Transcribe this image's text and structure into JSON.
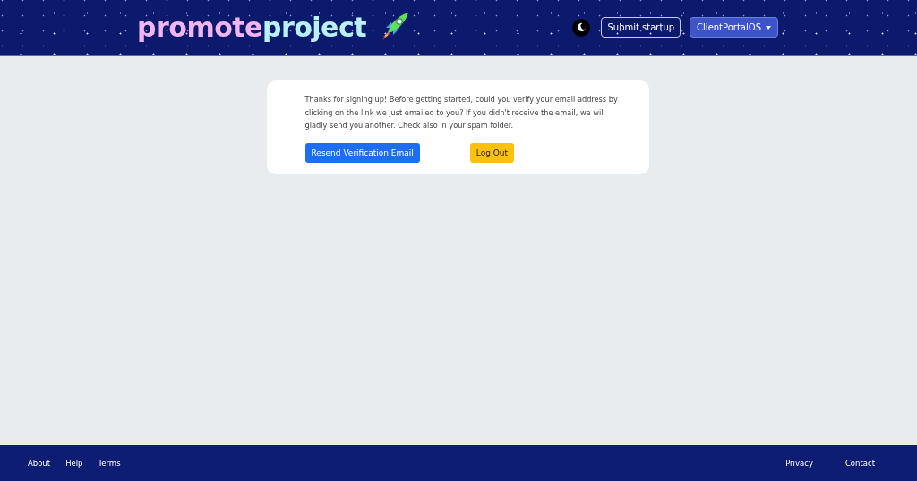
{
  "header": {
    "logo": {
      "part_1": "promote",
      "part_2": "project"
    },
    "theme_toggle": {
      "dark": true
    },
    "submit_button": "Submit startup",
    "account_menu": "ClientPortalOS"
  },
  "notice": {
    "message": "Thanks for signing up! Before getting started, could you verify your email address by clicking on the link we just emailed to you? If you didn't receive the email, we will gladly send you another. Check also in your spam folder.",
    "buttons": [
      {
        "label": "Resend Verification Email",
        "kind": "primary"
      },
      {
        "label": "Log Out",
        "kind": "warning"
      }
    ]
  },
  "footer": {
    "left_links": [
      "About",
      "Help",
      "Terms"
    ],
    "right_links": [
      "Privacy",
      "Contact"
    ]
  }
}
